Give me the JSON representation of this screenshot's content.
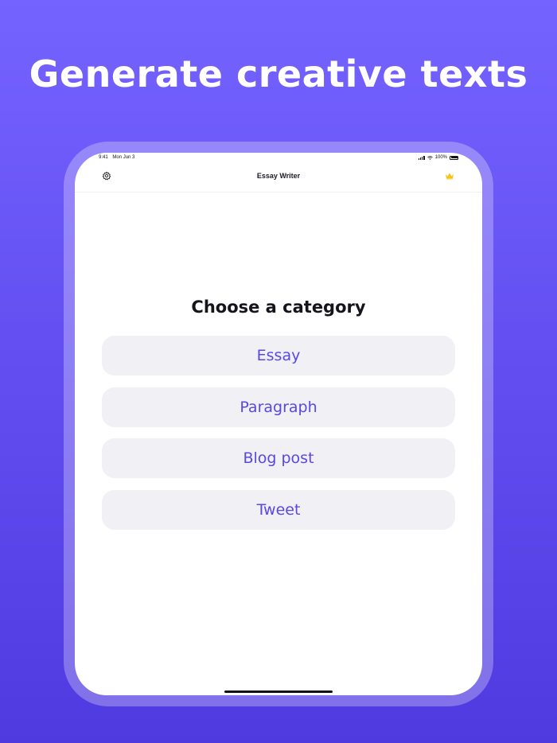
{
  "headline": "Generate creative texts",
  "status_bar": {
    "time": "9:41",
    "date": "Mon Jun 3",
    "battery": "100%"
  },
  "nav": {
    "title": "Essay Writer",
    "settings_icon": "gear-icon",
    "premium_icon": "crown-icon"
  },
  "main": {
    "title": "Choose a category",
    "categories": [
      {
        "label": "Essay"
      },
      {
        "label": "Paragraph"
      },
      {
        "label": "Blog post"
      },
      {
        "label": "Tweet"
      }
    ]
  },
  "colors": {
    "background_top": "#7563ff",
    "background_bottom": "#4f3ae0",
    "accent": "#5a48e2",
    "button_bg": "#f0f0f5",
    "crown": "#f5c518"
  }
}
